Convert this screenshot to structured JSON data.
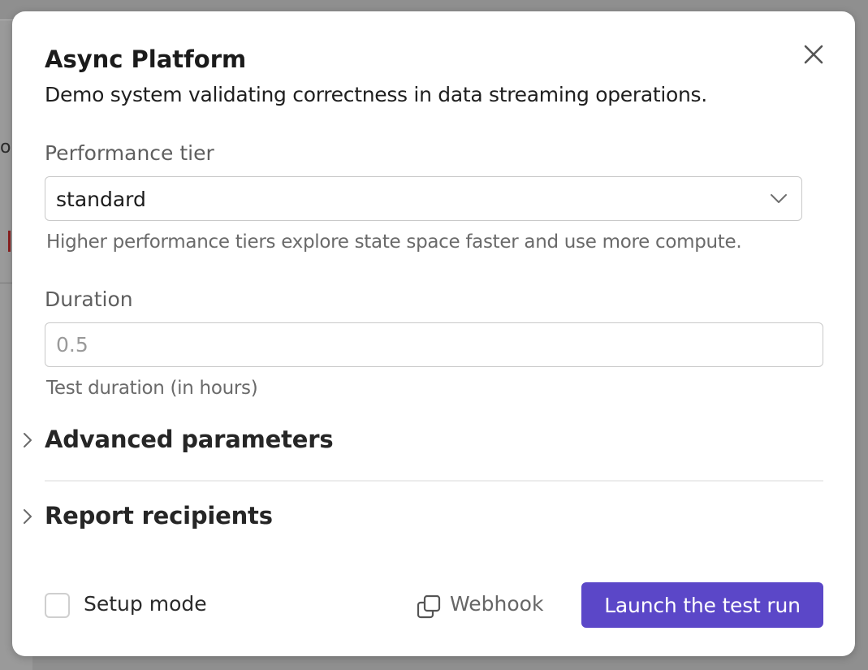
{
  "background": {
    "fragment_text": "or"
  },
  "modal": {
    "title": "Async Platform",
    "subtitle": "Demo system validating correctness in data streaming operations.",
    "close_icon": "close-icon"
  },
  "performance_tier": {
    "label": "Performance tier",
    "selected": "standard",
    "help": "Higher performance tiers explore state space faster and use more compute."
  },
  "duration": {
    "label": "Duration",
    "value": "",
    "placeholder": "0.5",
    "help": "Test duration (in hours)"
  },
  "sections": [
    {
      "title": "Advanced parameters",
      "expanded": false,
      "icon": "chevron-right-icon"
    },
    {
      "title": "Report recipients",
      "expanded": false,
      "icon": "chevron-right-icon"
    }
  ],
  "footer": {
    "setup_mode_label": "Setup mode",
    "setup_mode_checked": false,
    "webhook_label": "Webhook",
    "webhook_icon": "copy-icon",
    "launch_label": "Launch the test run"
  },
  "colors": {
    "accent": "#5b47c8",
    "overlay": "#8f8f8f",
    "surface": "#ffffff"
  }
}
